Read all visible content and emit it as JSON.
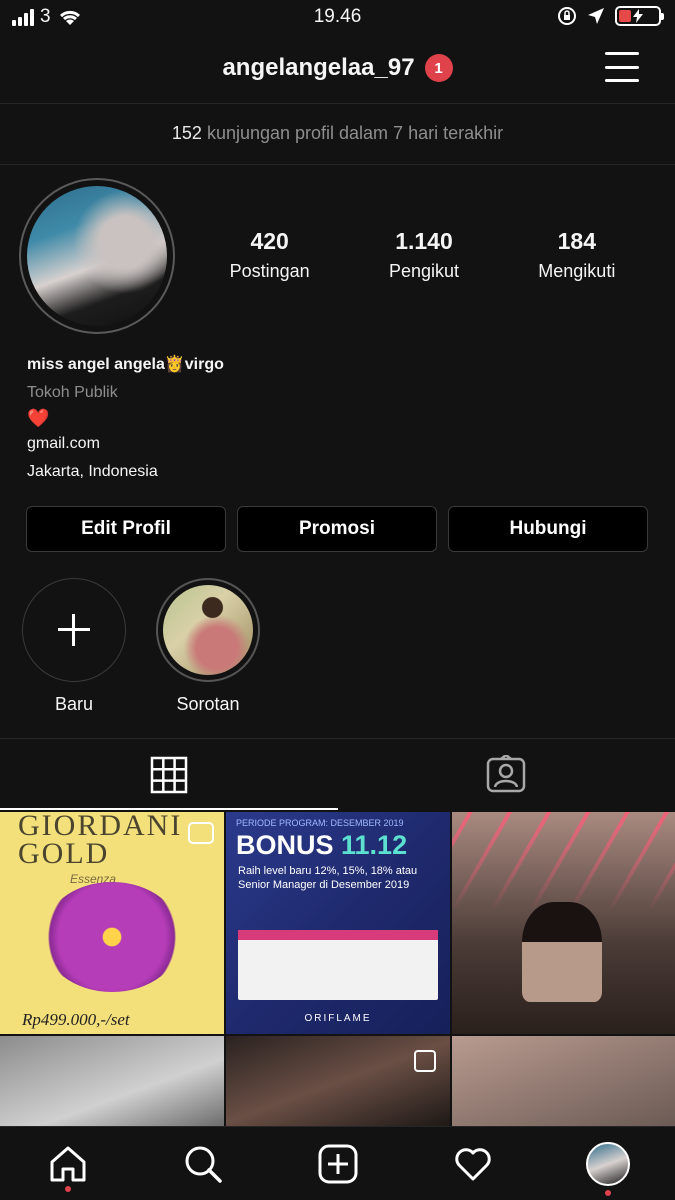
{
  "status_bar": {
    "carrier": "3",
    "time": "19.46"
  },
  "header": {
    "username": "angelangelaa_97",
    "notification_count": "1"
  },
  "visits": {
    "count": "152",
    "text": "kunjungan profil dalam 7 hari terakhir"
  },
  "profile": {
    "stats": [
      {
        "value": "420",
        "label": "Postingan"
      },
      {
        "value": "1.140",
        "label": "Pengikut"
      },
      {
        "value": "184",
        "label": "Mengikuti"
      }
    ],
    "name": "miss angel angela👸virgo",
    "category": "Tokoh Publik",
    "heart": "❤️",
    "link": "gmail.com",
    "location": "Jakarta, Indonesia"
  },
  "actions": {
    "edit": "Edit Profil",
    "promo": "Promosi",
    "contact": "Hubungi"
  },
  "highlights": [
    {
      "label": "Baru",
      "icon": "plus-icon"
    },
    {
      "label": "Sorotan",
      "icon": "highlight-thumbnail"
    }
  ],
  "tabs": {
    "grid_icon": "grid-icon",
    "tagged_icon": "tagged-icon"
  },
  "posts": {
    "post1": {
      "title": "GIORDANI GOLD",
      "subtitle": "Essenza",
      "price": "Rp499.000,-/set"
    },
    "post2": {
      "header": "PERIODE PROGRAM: DESEMBER 2019",
      "title_a": "BONUS ",
      "title_b": "11.12",
      "sub": "Raih level baru 12%, 15%, 18% atau Senior Manager di Desember 2019",
      "footer": "ORIFLAME"
    }
  },
  "colors": {
    "background": "#121212",
    "badge": "#e0424c",
    "muted": "#8e8e8e",
    "border": "#262626"
  }
}
